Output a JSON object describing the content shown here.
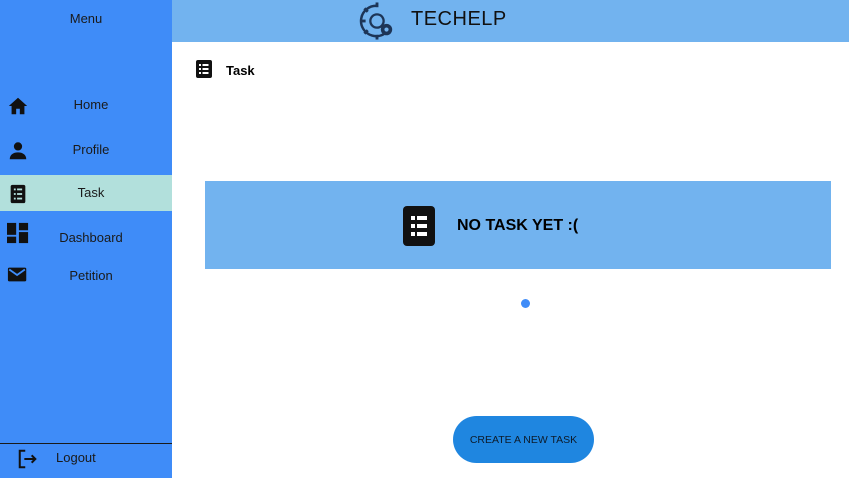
{
  "app": {
    "brand": "TECHELP"
  },
  "sidebar": {
    "menu_title": "Menu",
    "items": [
      {
        "label": "Home",
        "icon": "home-icon"
      },
      {
        "label": "Profile",
        "icon": "person-icon"
      },
      {
        "label": "Task",
        "icon": "task-list-icon",
        "active": true
      },
      {
        "label": "Dashboard",
        "icon": "dashboard-icon"
      },
      {
        "label": "Petition",
        "icon": "mail-icon"
      }
    ],
    "logout_label": "Logout"
  },
  "main": {
    "heading": "Task",
    "empty_message": "NO TASK YET :(",
    "create_button_label": "CREATE A NEW TASK"
  },
  "colors": {
    "sidebar": "#3f8cf8",
    "header": "#72b3ef",
    "active_item": "#b2e0dc",
    "banner": "#72b3ef",
    "button": "#1f86e0"
  }
}
